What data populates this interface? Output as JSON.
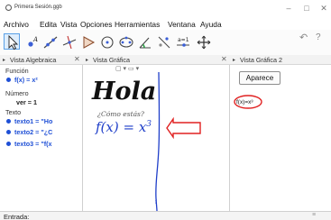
{
  "window": {
    "title": "Primera Sesión.ggb",
    "controls": [
      "–",
      "□",
      "✕"
    ]
  },
  "menu": {
    "items": [
      "Archivo",
      "Edita",
      "Vista",
      "Opciones",
      "Herramientas",
      "Ventana",
      "Ayuda"
    ]
  },
  "toolbar": {
    "tools": [
      "move-tool",
      "point-tool",
      "line-tool",
      "perpendicular-tool",
      "polygon-tool",
      "circle-tool",
      "conic-tool",
      "angle-tool",
      "reflect-tool",
      "slider-tool",
      "move-graphics-tool"
    ],
    "active_tool": "move-tool",
    "slider_tool_label": "a=1",
    "undo_icon": "undo-icon",
    "help_icon": "help-icon"
  },
  "algebra_view": {
    "title": "Vista Algebraica",
    "sections": [
      {
        "label": "Función",
        "items": [
          {
            "text": "f(x) = x²",
            "bold": true
          }
        ]
      },
      {
        "label": "Número",
        "items": [
          {
            "text": "ver = 1",
            "bold": true
          }
        ]
      },
      {
        "label": "Texto",
        "items": [
          {
            "text": "texto1 = \"Ho",
            "bold": true
          },
          {
            "text": "texto2 = \"¿C",
            "bold": true
          },
          {
            "text": "texto3 = \"f(x",
            "bold": true
          }
        ]
      }
    ]
  },
  "graphics_view": {
    "title": "Vista Gráfica",
    "texts": {
      "hola": "Hola",
      "como": "¿Cómo estás?",
      "function_label": "f(x) = x",
      "function_exponent": "3",
      "axis_label": "f"
    },
    "arrow_color": "#e02020",
    "curve_color": "#1e3ec9"
  },
  "graphics_view_2": {
    "title": "Vista Gráfica 2",
    "button_label": "Aparece",
    "formula_text": "f(x)=x³",
    "circle_color": "#e02020"
  },
  "input_bar": {
    "label": "Entrada:",
    "value": ""
  }
}
